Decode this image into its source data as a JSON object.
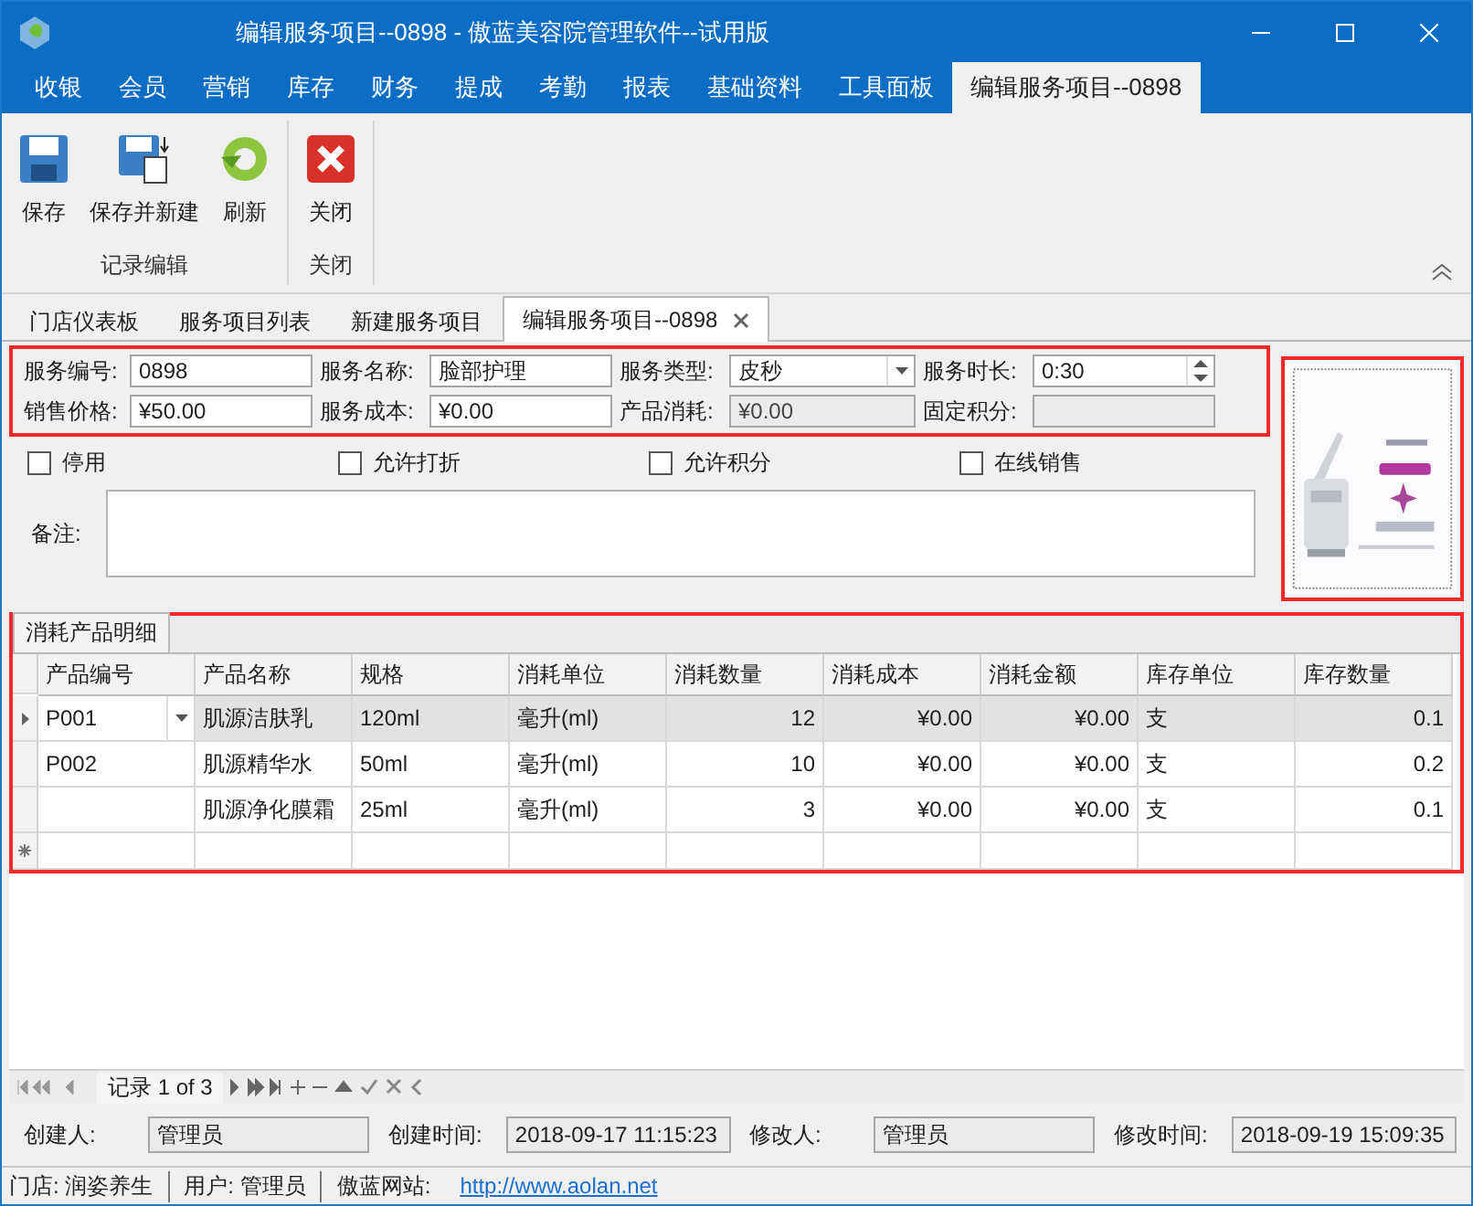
{
  "window": {
    "title": "编辑服务项目--0898 - 傲蓝美容院管理软件--试用版"
  },
  "menu_tabs": [
    {
      "label": "收银",
      "selected": false
    },
    {
      "label": "会员",
      "selected": false
    },
    {
      "label": "营销",
      "selected": false
    },
    {
      "label": "库存",
      "selected": false
    },
    {
      "label": "财务",
      "selected": false
    },
    {
      "label": "提成",
      "selected": false
    },
    {
      "label": "考勤",
      "selected": false
    },
    {
      "label": "报表",
      "selected": false
    },
    {
      "label": "基础资料",
      "selected": false
    },
    {
      "label": "工具面板",
      "selected": false
    },
    {
      "label": "编辑服务项目--0898",
      "selected": true
    }
  ],
  "ribbon": {
    "groups": [
      {
        "label": "记录编辑",
        "buttons": [
          {
            "label": "保存",
            "kind": "save"
          },
          {
            "label": "保存并新建",
            "kind": "save_new"
          },
          {
            "label": "刷新",
            "kind": "refresh"
          }
        ]
      },
      {
        "label": "关闭",
        "buttons": [
          {
            "label": "关闭",
            "kind": "close"
          }
        ]
      }
    ]
  },
  "document_tabs": [
    {
      "label": "门店仪表板",
      "selected": false,
      "closable": false
    },
    {
      "label": "服务项目列表",
      "selected": false,
      "closable": false
    },
    {
      "label": "新建服务项目",
      "selected": false,
      "closable": false
    },
    {
      "label": "编辑服务项目--0898",
      "selected": true,
      "closable": true
    }
  ],
  "form": {
    "highlighted": true,
    "fields": [
      {
        "label": "服务编号:",
        "value": "0898",
        "kind": "text",
        "disabled": false
      },
      {
        "label": "服务名称:",
        "value": "脸部护理",
        "kind": "text",
        "disabled": false
      },
      {
        "label": "服务类型:",
        "value": "皮秒",
        "kind": "combo",
        "disabled": false
      },
      {
        "label": "服务时长:",
        "value": "0:30",
        "kind": "spin",
        "disabled": false
      },
      {
        "label": "销售价格:",
        "value": "¥50.00",
        "kind": "text",
        "disabled": false
      },
      {
        "label": "服务成本:",
        "value": "¥0.00",
        "kind": "text",
        "disabled": false
      },
      {
        "label": "产品消耗:",
        "value": "¥0.00",
        "kind": "text",
        "disabled": true
      },
      {
        "label": "固定积分:",
        "kind": "text",
        "disabled": true
      }
    ],
    "checkboxes": [
      {
        "label": "停用",
        "checked": false
      },
      {
        "label": "允许打折",
        "checked": false
      },
      {
        "label": "允许积分",
        "checked": false
      },
      {
        "label": "在线销售",
        "checked": false
      }
    ],
    "remark": {
      "label": "备注:"
    }
  },
  "photo": {
    "kind": "picture",
    "highlighted": true
  },
  "detail": {
    "highlighted": true,
    "tab": "消耗产品明细",
    "columns": [
      "产品编号",
      "产品名称",
      "规格",
      "消耗单位",
      "消耗数量",
      "消耗成本",
      "消耗金额",
      "库存单位",
      "库存数量"
    ],
    "rows": [
      {
        "selected": true,
        "cells": [
          "P001",
          "肌源洁肤乳",
          "120ml",
          "毫升(ml)",
          "12",
          "¥0.00",
          "¥0.00",
          "支",
          "0.1"
        ]
      },
      {
        "selected": false,
        "cells": [
          "P002",
          "肌源精华水",
          "50ml",
          "毫升(ml)",
          "10",
          "¥0.00",
          "¥0.00",
          "支",
          "0.2"
        ]
      },
      {
        "selected": false,
        "cells": [
          "",
          "肌源净化膜霜",
          "25ml",
          "毫升(ml)",
          "3",
          "¥0.00",
          "¥0.00",
          "支",
          "0.1"
        ]
      }
    ],
    "navigator": "记录 1 of 3"
  },
  "audit": [
    {
      "label": "创建人:",
      "value": "管理员"
    },
    {
      "label": "创建时间:",
      "value": "2018-09-17 11:15:23"
    },
    {
      "label": "修改人:",
      "value": "管理员"
    },
    {
      "label": "修改时间:",
      "value": "2018-09-19 15:09:35"
    }
  ],
  "status_bar": {
    "items": [
      "门店: 润姿养生",
      "用户: 管理员",
      "傲蓝网站:"
    ],
    "link": "http://www.aolan.net"
  }
}
